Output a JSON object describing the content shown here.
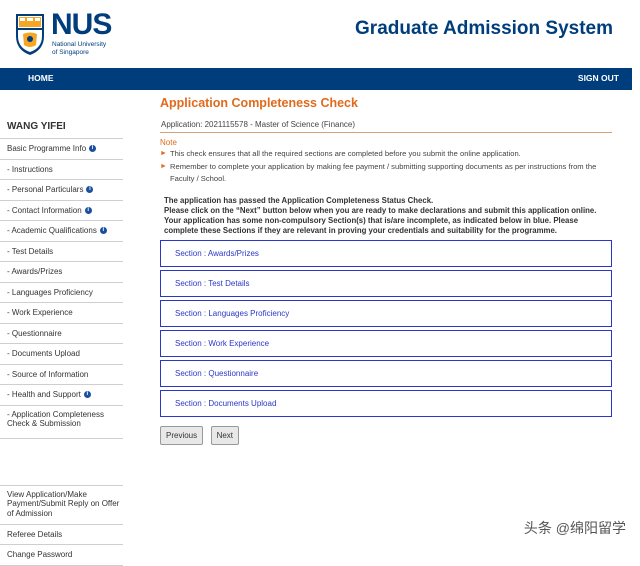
{
  "header": {
    "logo_text": "NUS",
    "logo_subtitle_line1": "National University",
    "logo_subtitle_line2": "of Singapore",
    "system_title": "Graduate Admission System"
  },
  "nav": {
    "home": "HOME",
    "sign_out": "SIGN OUT"
  },
  "sidebar": {
    "user_name": "WANG YIFEI",
    "items": [
      {
        "label": "Basic Programme Info",
        "info": true
      },
      {
        "label": "- Instructions",
        "info": false
      },
      {
        "label": "- Personal Particulars",
        "info": true
      },
      {
        "label": "- Contact Information",
        "info": true
      },
      {
        "label": "- Academic Qualifications",
        "info": true
      },
      {
        "label": "- Test Details",
        "info": false
      },
      {
        "label": "- Awards/Prizes",
        "info": false
      },
      {
        "label": "- Languages Proficiency",
        "info": false
      },
      {
        "label": "- Work Experience",
        "info": false
      },
      {
        "label": "- Questionnaire",
        "info": false
      },
      {
        "label": "- Documents Upload",
        "info": false
      },
      {
        "label": "- Source of Information",
        "info": false
      },
      {
        "label": "- Health and Support",
        "info": true
      },
      {
        "label": "- Application Completeness Check & Submission",
        "info": false
      }
    ],
    "bottom_items": [
      {
        "label": "View Application/Make Payment/Submit Reply on Offer of Admission"
      },
      {
        "label": "Referee Details"
      },
      {
        "label": "Change Password"
      }
    ]
  },
  "main": {
    "title": "Application Completeness Check",
    "application_line": "Application: 2021115578 - Master of Science (Finance)",
    "note_label": "Note",
    "notes": [
      "This check ensures that all the required sections are completed before you submit the online application.",
      "Remember to complete your application by making fee payment / submitting supporting documents as per instructions from the Faculty / School."
    ],
    "passed_line1": "The application has passed the Application Completeness Status Check.",
    "passed_line2": "Please click on the “Next” button below when you are ready to make declarations and submit this application online.",
    "passed_line3": "Your application has some non-compulsory Section(s) that is/are incomplete, as indicated below in blue. Please complete these Sections if they are relevant in proving your credentials and suitability for the programme.",
    "sections": [
      "Section : Awards/Prizes",
      "Section : Test Details",
      "Section : Languages Proficiency",
      "Section : Work Experience",
      "Section : Questionnaire",
      "Section : Documents Upload"
    ],
    "previous_label": "Previous",
    "next_label": "Next"
  },
  "watermark": "头条 @绵阳留学",
  "colors": {
    "brand_blue": "#003d7c",
    "accent_orange": "#e06a1b",
    "section_blue": "#2b36c9"
  }
}
